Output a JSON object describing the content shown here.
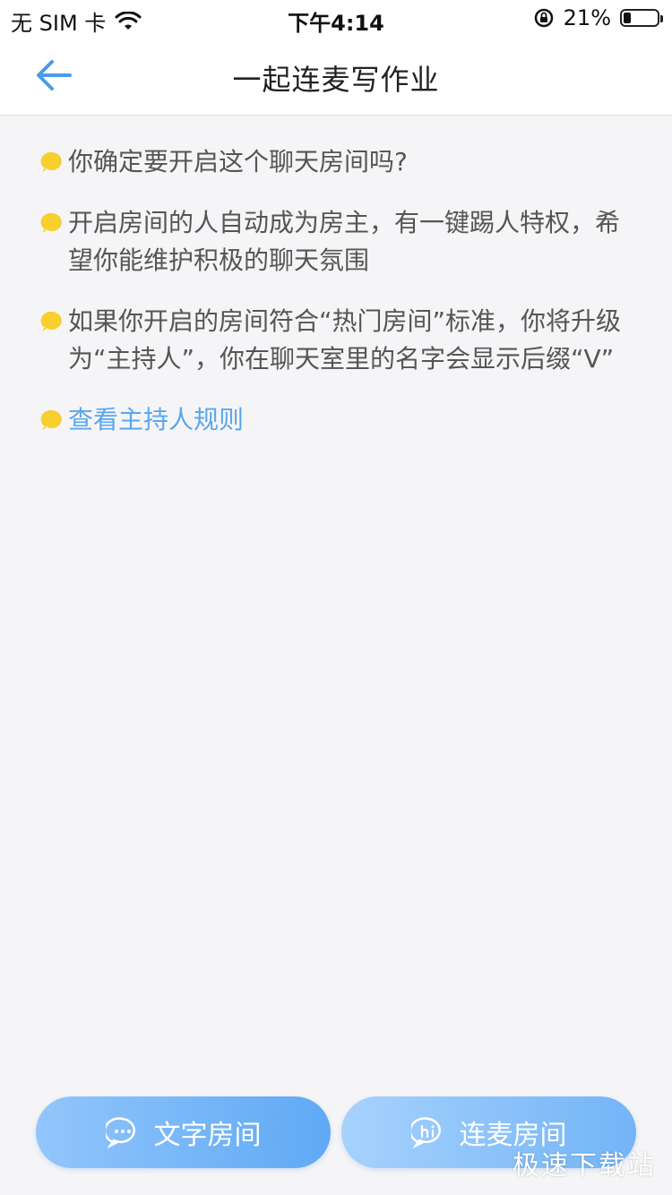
{
  "status_bar": {
    "carrier": "无 SIM 卡",
    "time": "下午4:14",
    "battery_percent": "21%",
    "battery_level": 0.21,
    "icons": [
      "wifi-icon",
      "orientation-lock-icon",
      "battery-icon"
    ]
  },
  "nav": {
    "title": "一起连麦写作业",
    "back_icon": "back-arrow-icon"
  },
  "tips": [
    {
      "text": "你确定要开启这个聊天房间吗?"
    },
    {
      "text": "开启房间的人自动成为房主，有一键踢人特权，希望你能维护积极的聊天氛围"
    },
    {
      "text": "如果你开启的房间符合“热门房间”标准，你将升级为“主持人”，你在聊天室里的名字会显示后缀“V”"
    }
  ],
  "rules_link": "查看主持人规则",
  "buttons": {
    "text_room": "文字房间",
    "voice_room": "连麦房间"
  },
  "watermark": "极速下载站",
  "colors": {
    "accent": "#5aa6ee",
    "bullet": "#f7cf2e",
    "button_start": "#92c6fb",
    "button_end": "#5fa9f5"
  }
}
